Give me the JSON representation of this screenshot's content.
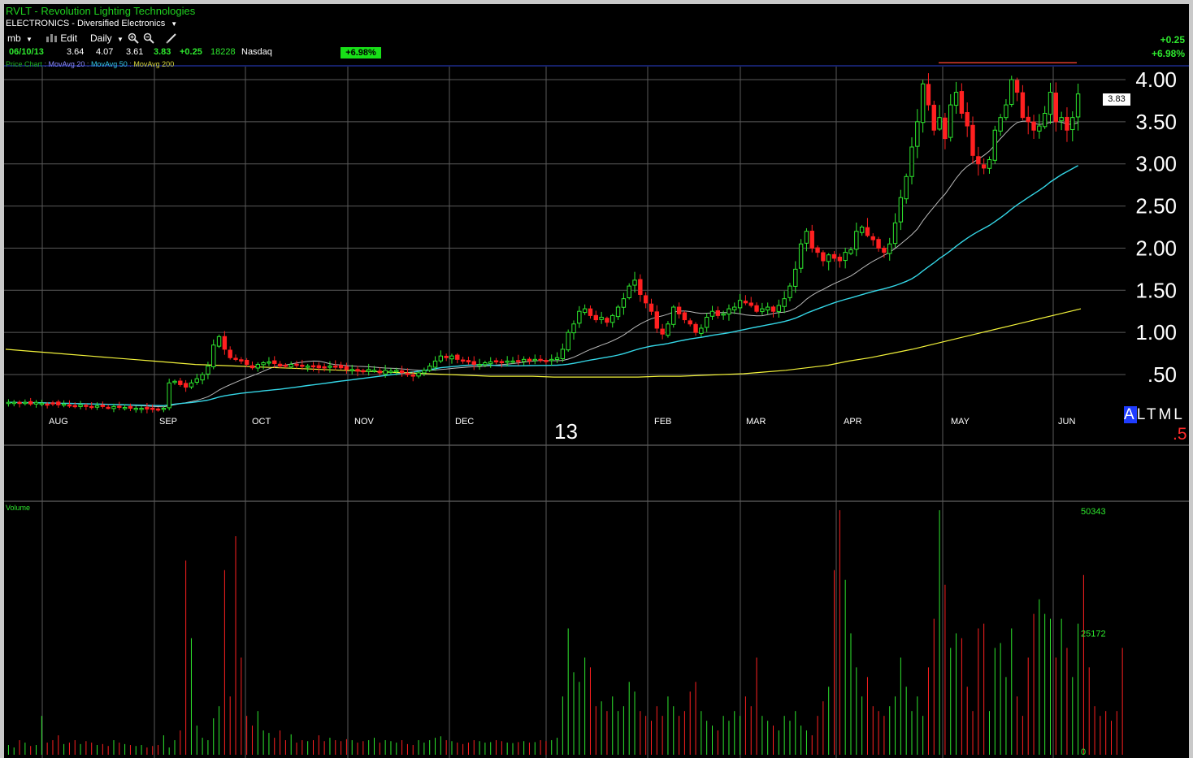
{
  "header": {
    "title": "RVLT - Revolution Lighting Technologies",
    "industry": "ELECTRONICS - Diversified Electronics"
  },
  "toolbar": {
    "user": "mb",
    "edit": "Edit",
    "period": "Daily"
  },
  "quote": {
    "date": "06/10/13",
    "open": "3.64",
    "high": "4.07",
    "low": "3.61",
    "close": "3.83",
    "change": "+0.25",
    "volume": "18228",
    "exchange": "Nasdaq",
    "pct_change": "+6.98%",
    "right_change": "+0.25",
    "right_pct": "+6.98%",
    "last_price_box": "3.83"
  },
  "legend": {
    "price_chart": "Price Chart",
    "ma20": "MovAvg 20",
    "ma50": "MovAvg 50",
    "ma200": "MovAvg 200",
    "volume_title": "Volume"
  },
  "overlay": {
    "year_label": "13",
    "altml": [
      "A",
      "L",
      "T",
      "M",
      "L"
    ],
    "red_text": ".5"
  },
  "colors": {
    "up": "#2ee82e",
    "down": "#ff2020",
    "ma20": "#b9b9b9",
    "ma50": "#34d6e6",
    "ma200": "#f2f23a",
    "grid": "#5a5a5a",
    "resistance": "#e03c2c",
    "top_line": "#2a3fd0"
  },
  "chart_data": [
    {
      "type": "candlestick",
      "title": "RVLT - Revolution Lighting Technologies",
      "xlabel": "",
      "ylabel": "",
      "x_tick_labels": [
        "AUG",
        "SEP",
        "OCT",
        "NOV",
        "DEC",
        "FEB",
        "MAR",
        "APR",
        "MAY",
        "JUN"
      ],
      "y_ticks": [
        0.5,
        1.0,
        1.5,
        2.0,
        2.5,
        3.0,
        3.5,
        4.0
      ],
      "y_tick_labels": [
        ".50",
        "1.00",
        "1.50",
        "2.00",
        "2.50",
        "3.00",
        "3.50",
        "4.00"
      ],
      "ylim": [
        -0.1,
        4.2
      ],
      "grid": true,
      "resistance_level": 4.2,
      "close": [
        0.17,
        0.17,
        0.16,
        0.17,
        0.15,
        0.17,
        0.16,
        0.15,
        0.16,
        0.14,
        0.15,
        0.14,
        0.13,
        0.14,
        0.13,
        0.12,
        0.13,
        0.12,
        0.11,
        0.12,
        0.11,
        0.11,
        0.1,
        0.1,
        0.1,
        0.09,
        0.09,
        0.09,
        0.1,
        0.4,
        0.42,
        0.38,
        0.35,
        0.4,
        0.45,
        0.5,
        0.6,
        0.85,
        0.95,
        0.8,
        0.7,
        0.68,
        0.66,
        0.62,
        0.58,
        0.62,
        0.64,
        0.65,
        0.63,
        0.6,
        0.6,
        0.62,
        0.61,
        0.6,
        0.6,
        0.6,
        0.58,
        0.58,
        0.6,
        0.6,
        0.58,
        0.56,
        0.56,
        0.54,
        0.54,
        0.56,
        0.55,
        0.52,
        0.55,
        0.54,
        0.55,
        0.52,
        0.5,
        0.48,
        0.52,
        0.55,
        0.6,
        0.66,
        0.72,
        0.7,
        0.72,
        0.68,
        0.66,
        0.65,
        0.62,
        0.62,
        0.64,
        0.65,
        0.66,
        0.65,
        0.66,
        0.66,
        0.66,
        0.68,
        0.66,
        0.68,
        0.68,
        0.66,
        0.68,
        0.7,
        0.8,
        1.0,
        1.1,
        1.25,
        1.28,
        1.2,
        1.15,
        1.18,
        1.12,
        1.2,
        1.3,
        1.4,
        1.55,
        1.62,
        1.45,
        1.35,
        1.25,
        1.05,
        0.98,
        1.1,
        1.3,
        1.22,
        1.15,
        1.1,
        1.0,
        1.05,
        1.18,
        1.25,
        1.2,
        1.22,
        1.28,
        1.3,
        1.38,
        1.35,
        1.32,
        1.25,
        1.28,
        1.3,
        1.25,
        1.32,
        1.4,
        1.55,
        1.75,
        2.05,
        2.2,
        2.0,
        1.95,
        1.85,
        1.92,
        1.88,
        1.85,
        1.95,
        1.98,
        2.2,
        2.25,
        2.15,
        2.1,
        2.0,
        1.95,
        2.05,
        2.3,
        2.6,
        2.85,
        3.2,
        3.5,
        3.95,
        3.7,
        3.4,
        3.55,
        3.3,
        3.7,
        3.85,
        3.6,
        3.45,
        3.1,
        3.0,
        2.95,
        3.05,
        3.4,
        3.55,
        3.7,
        4.0,
        3.85,
        3.55,
        3.5,
        3.4,
        3.45,
        3.6,
        3.85,
        3.5,
        3.55,
        3.4,
        3.55,
        3.83
      ],
      "series": [
        {
          "name": "MovAvg 20",
          "role": "ma20"
        },
        {
          "name": "MovAvg 50",
          "role": "ma50"
        },
        {
          "name": "MovAvg 200",
          "role": "ma200",
          "values": [
            0.8,
            0.78,
            0.76,
            0.74,
            0.72,
            0.7,
            0.68,
            0.66,
            0.64,
            0.62,
            0.61,
            0.6,
            0.59,
            0.58,
            0.57,
            0.56,
            0.55,
            0.54,
            0.53,
            0.52,
            0.51,
            0.5,
            0.49,
            0.48,
            0.48,
            0.48,
            0.47,
            0.47,
            0.47,
            0.47,
            0.47,
            0.48,
            0.48,
            0.49,
            0.5,
            0.51,
            0.53,
            0.55,
            0.58,
            0.61,
            0.66,
            0.7,
            0.75,
            0.8,
            0.86,
            0.92,
            0.98,
            1.04,
            1.1,
            1.16,
            1.22,
            1.28
          ]
        }
      ]
    },
    {
      "type": "bar",
      "title": "Volume",
      "y_tick_labels": [
        "50343",
        "25172",
        "0"
      ],
      "ylim": [
        0,
        50343
      ],
      "values": [
        2000,
        1500,
        3000,
        2500,
        1800,
        2000,
        8000,
        2500,
        3000,
        4000,
        2200,
        2500,
        3000,
        2200,
        2800,
        2500,
        2000,
        2200,
        1800,
        3000,
        2500,
        2200,
        2000,
        1800,
        2000,
        1500,
        1800,
        2000,
        4000,
        1500,
        3000,
        5000,
        40000,
        24000,
        6000,
        3500,
        3000,
        7500,
        10000,
        38000,
        12000,
        45000,
        20000,
        8000,
        6000,
        9000,
        5000,
        4500,
        3500,
        5000,
        3000,
        4200,
        2500,
        3000,
        2800,
        3000,
        4000,
        2800,
        3500,
        3000,
        2800,
        3200,
        3000,
        2500,
        2800,
        3000,
        3500,
        2500,
        3000,
        2800,
        2500,
        3000,
        2200,
        2000,
        3000,
        2500,
        3000,
        3500,
        3800,
        3000,
        2800,
        2500,
        2200,
        2500,
        3000,
        2800,
        2500,
        2600,
        3000,
        2800,
        2500,
        2400,
        2600,
        2800,
        2500,
        2600,
        3000,
        2800,
        3000,
        3500,
        12000,
        26000,
        17000,
        15000,
        20000,
        18000,
        10000,
        11000,
        9000,
        12000,
        9000,
        10000,
        15000,
        13000,
        9000,
        8000,
        7000,
        10000,
        8000,
        12000,
        10000,
        8000,
        9000,
        13000,
        15000,
        9000,
        7000,
        6000,
        5000,
        8000,
        7000,
        9000,
        8000,
        12000,
        10000,
        20000,
        8000,
        7000,
        6000,
        5000,
        8000,
        7000,
        9000,
        6000,
        5000,
        4000,
        8000,
        11000,
        14000,
        38000,
        50343,
        36000,
        25000,
        18000,
        12000,
        16000,
        10000,
        9000,
        8000,
        10000,
        12000,
        20000,
        14000,
        9000,
        12000,
        8000,
        18000,
        28000,
        50343,
        35000,
        22000,
        25000,
        24000,
        14000,
        9000,
        26000,
        27000,
        9000,
        22000,
        23000,
        16000,
        26000,
        12000,
        8000,
        20000,
        29000,
        32000,
        29000,
        28000,
        20000,
        28000,
        22000,
        16000,
        27000,
        37000,
        18000,
        10000,
        8000,
        9000,
        7000,
        9000,
        22000
      ]
    }
  ]
}
